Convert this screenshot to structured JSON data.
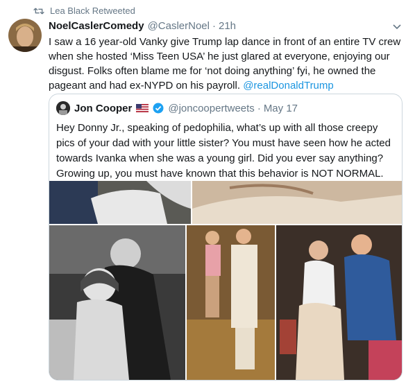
{
  "retweet": {
    "label": "Lea Black Retweeted"
  },
  "tweet": {
    "author_name": "NoelCaslerComedy",
    "author_handle": "@CaslerNoel",
    "separator": "·",
    "time": "21h",
    "text": "I saw a 16 year-old Vanky give Trump lap dance in front of an entire TV crew when she hosted ‘Miss Teen USA’ he just glared at everyone, enjoying our disgust. Folks often blame me for ‘not doing anything’ fyi, he owned the pageant and had ex-NYPD on his payroll. ",
    "mention": "@realDonaldTrump"
  },
  "quoted": {
    "author_name": "Jon Cooper",
    "author_handle": "@joncoopertweets",
    "separator": "·",
    "date": "May 17",
    "text": "Hey Donny Jr., speaking of pedophilia, what’s up with all those creepy pics of your dad with your little sister? You must have seen how he acted towards Ivanka when she was a young girl. Did you ever say anything? Growing up, you must have known that this behavior is NOT NORMAL."
  },
  "icons": {
    "retweet": "retweet-icon",
    "caret": "chevron-down-icon",
    "verified": "verified-badge-icon",
    "flag": "us-flag-icon"
  },
  "colors": {
    "link": "#1b95e0",
    "muted": "#657786",
    "border": "#ccd6dd"
  }
}
